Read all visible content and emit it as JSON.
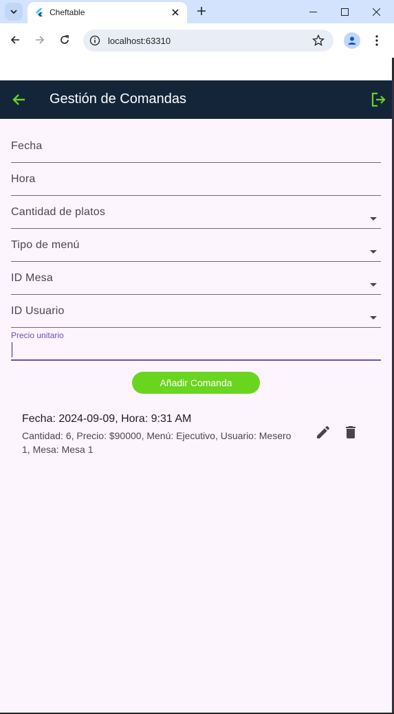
{
  "browser": {
    "tab_title": "Cheftable",
    "url": "localhost:63310"
  },
  "appbar": {
    "title": "Gestión de Comandas"
  },
  "form": {
    "fecha_label": "Fecha",
    "hora_label": "Hora",
    "cantidad_label": "Cantidad de platos",
    "menu_label": "Tipo de menú",
    "mesa_label": "ID Mesa",
    "usuario_label": "ID Usuario",
    "precio_label": "Precio unitario",
    "precio_value": "",
    "add_button": "Añadir Comanda"
  },
  "comandas": [
    {
      "title": "Fecha: 2024-09-09, Hora: 9:31 AM",
      "subtitle": "Cantidad: 6, Precio: $90000, Menú: Ejecutivo, Usuario: Mesero 1, Mesa: Mesa 1"
    }
  ],
  "colors": {
    "appbar": "#14253a",
    "accent": "#6ad51f",
    "focus": "#6a4fb0",
    "background": "#fdf5fd"
  }
}
